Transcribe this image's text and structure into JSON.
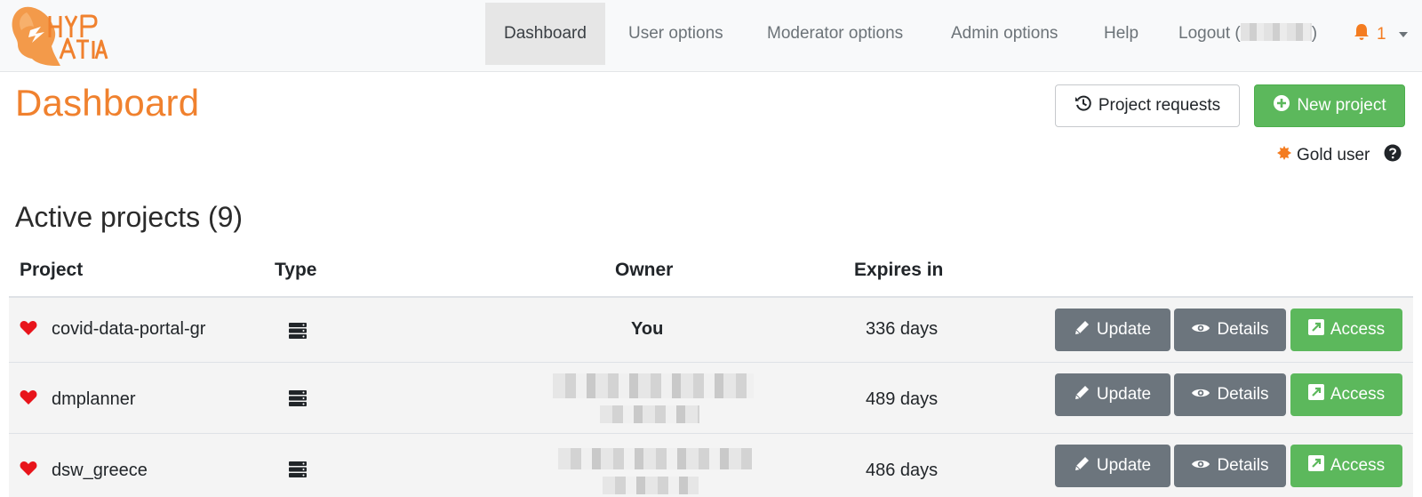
{
  "navbar": {
    "logo_text": "HYPATIA",
    "items": [
      {
        "label": "Dashboard"
      },
      {
        "label": "User options"
      },
      {
        "label": "Moderator options"
      },
      {
        "label": "Admin options"
      },
      {
        "label": "Help"
      },
      {
        "label_prefix": "Logout (",
        "label_suffix": ")"
      }
    ],
    "notification_count": "1"
  },
  "header": {
    "title": "Dashboard",
    "project_requests_label": "Project requests",
    "new_project_label": "New project",
    "user_level": "Gold user"
  },
  "section": {
    "title": "Active projects (9)"
  },
  "table": {
    "columns": [
      "Project",
      "Type",
      "Owner",
      "Expires in"
    ],
    "rows": [
      {
        "project": "covid-data-portal-gr",
        "owner": "You",
        "expires": "336 days"
      },
      {
        "project": "dmplanner",
        "owner": "",
        "expires": "489 days"
      },
      {
        "project": "dsw_greece",
        "owner": "",
        "expires": "486 days"
      }
    ],
    "actions": {
      "update": "Update",
      "details": "Details",
      "access": "Access"
    }
  },
  "colors": {
    "brand": "#f0812e",
    "success": "#5cb85c",
    "secondary": "#6c757d",
    "heart": "#e8141b"
  }
}
